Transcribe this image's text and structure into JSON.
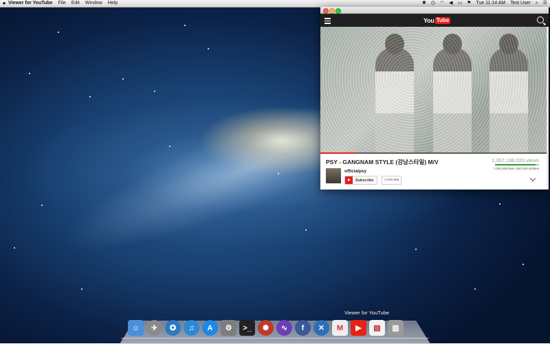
{
  "menubar": {
    "app_name": "Viewer for YouTube",
    "menus": [
      "File",
      "Edit",
      "Window",
      "Help"
    ],
    "clock": "Tue 11:14 AM",
    "user": "Test User"
  },
  "youtube": {
    "logo_you": "You",
    "logo_tube": "Tube",
    "video_title": "PSY - GANGNAM STYLE (강남스타일) M/V",
    "views": "1,357,198,020 views",
    "likes_dislikes": "7,090,536 likes, 650,200 dislikes",
    "like_ratio": 0.916,
    "progress": 0.16,
    "channel": "officialpsy",
    "subscribe_label": "Subscribe",
    "subscriber_count": "3,045,688"
  },
  "dock": {
    "hover_label": "Viewer for YouTube",
    "apps": [
      {
        "name": "finder",
        "color": "#4a90d9"
      },
      {
        "name": "launchpad",
        "color": "#8a8a8a"
      },
      {
        "name": "safari",
        "color": "#2f78c4"
      },
      {
        "name": "itunes",
        "color": "#2b8ad8"
      },
      {
        "name": "app-store",
        "color": "#1e88e5"
      },
      {
        "name": "system-preferences",
        "color": "#7d7d7d"
      },
      {
        "name": "terminal",
        "color": "#222222"
      },
      {
        "name": "app-red-orb",
        "color": "#c0392b"
      },
      {
        "name": "app-purple-wave",
        "color": "#6c3fb5"
      },
      {
        "name": "facebook",
        "color": "#3b5998"
      },
      {
        "name": "xcode",
        "color": "#2c6fb8"
      },
      {
        "name": "gmail",
        "color": "#eeeeee"
      },
      {
        "name": "viewer-for-youtube",
        "color": "#e62117"
      },
      {
        "name": "pdf-document",
        "color": "#f2f2f2"
      },
      {
        "name": "trash",
        "color": "#9a9a9a"
      }
    ]
  }
}
